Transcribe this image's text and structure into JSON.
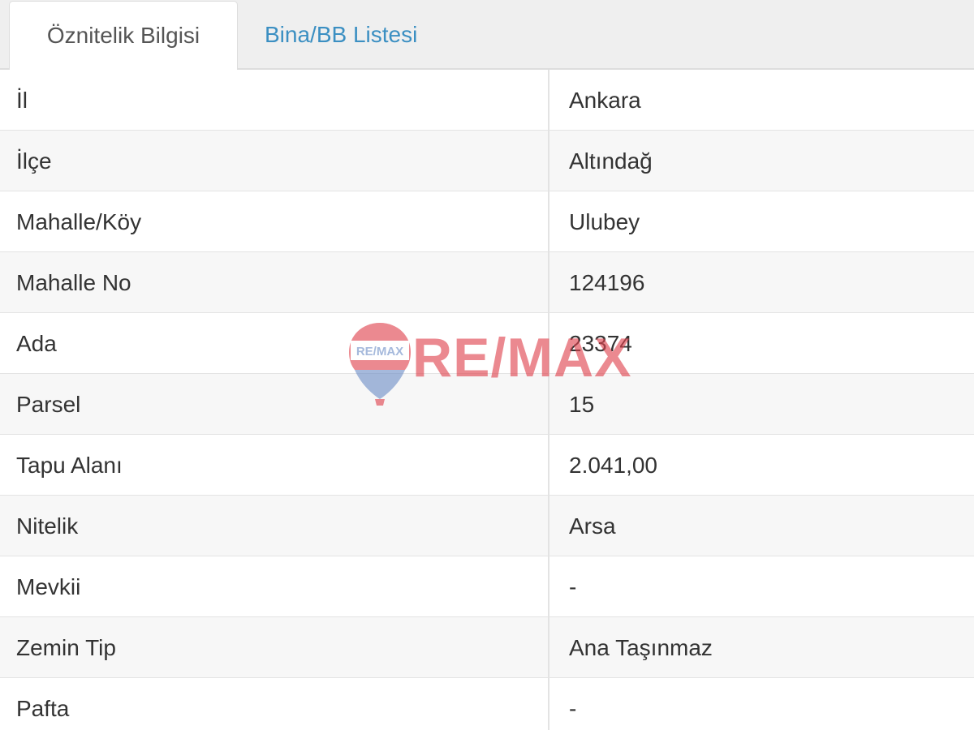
{
  "tabs": [
    {
      "label": "Öznitelik Bilgisi",
      "active": true
    },
    {
      "label": "Bina/BB Listesi",
      "active": false
    }
  ],
  "rows": [
    {
      "key": "İl",
      "value": "Ankara"
    },
    {
      "key": "İlçe",
      "value": "Altındağ"
    },
    {
      "key": "Mahalle/Köy",
      "value": "Ulubey"
    },
    {
      "key": "Mahalle No",
      "value": "124196"
    },
    {
      "key": "Ada",
      "value": "23374"
    },
    {
      "key": "Parsel",
      "value": "15"
    },
    {
      "key": "Tapu Alanı",
      "value": "2.041,00"
    },
    {
      "key": "Nitelik",
      "value": "Arsa"
    },
    {
      "key": "Mevkii",
      "value": "-"
    },
    {
      "key": "Zemin Tip",
      "value": "Ana Taşınmaz"
    },
    {
      "key": "Pafta",
      "value": "-"
    }
  ],
  "watermark": {
    "brand": "RE/MAX",
    "balloon_label": "RE/MAX",
    "icon": "hot-air-balloon-icon",
    "colors": {
      "red": "#e0424d",
      "blue": "#6f8fc7"
    }
  },
  "colors": {
    "link": "#3b8fc2",
    "text": "#333333",
    "tabbar_bg": "#efefef",
    "row_alt_bg": "#f7f7f7",
    "border": "#e3e3e3"
  }
}
